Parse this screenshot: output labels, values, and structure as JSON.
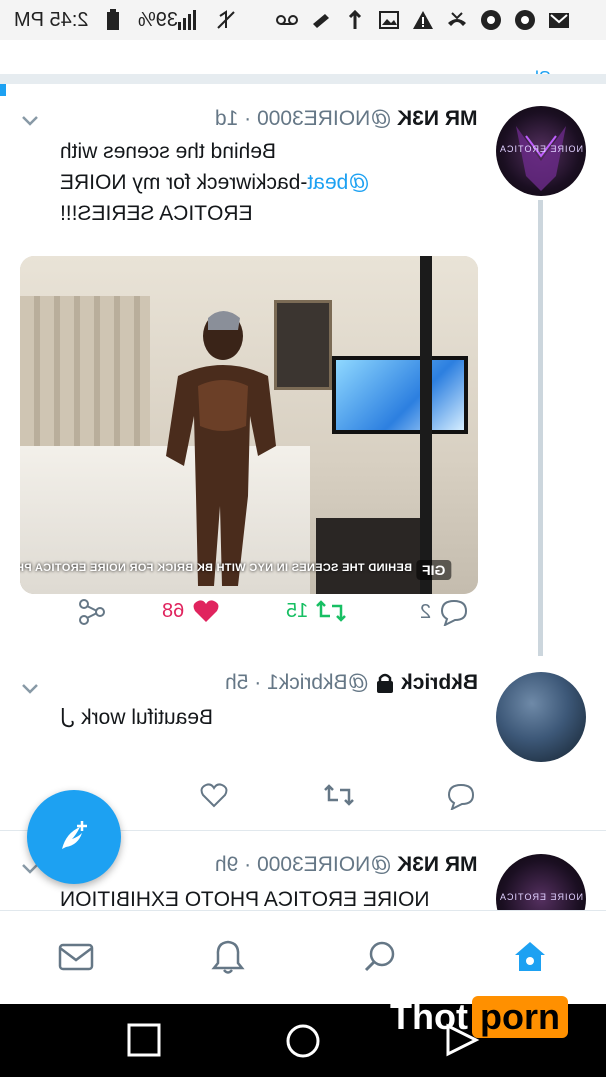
{
  "status_bar": {
    "time": "2:45 PM",
    "battery": "39%",
    "network": "LTE",
    "icons": [
      "signal-icon",
      "mute-icon",
      "voicemail-icon",
      "slash-icon",
      "upload-icon",
      "image-icon",
      "warning-icon",
      "missed-call-icon",
      "chrome-icon",
      "chrome-icon",
      "gmail-icon"
    ]
  },
  "feed": {
    "show_more": "Show more"
  },
  "tweets": [
    {
      "name": "MR N3K",
      "handle": "@NOIRE3000 · 1d",
      "avatar_label": "NOIRE EROTICA",
      "body_lines": [
        "Behind the scenes with",
        "-backiwreck for my NOIRE",
        "EROTICA SERIES!!!"
      ],
      "mention": "@beat",
      "media": {
        "badge": "GIF",
        "caption": "BEHIND THE SCENES IN NYC WITH BK BRICK FOR NOIRE EROTICA PHOTO SERIES"
      },
      "actions": {
        "replies": "2",
        "retweets": "15",
        "likes": "68"
      }
    },
    {
      "name": "Bkbrick",
      "handle": "@Bkbrick1 · 5h",
      "body_lines": [
        "Beautiful work ل"
      ],
      "actions": {
        "replies": "",
        "retweets": "",
        "likes": ""
      }
    },
    {
      "name": "MR N3K",
      "handle": "@NOIRE3000 · 9h",
      "avatar_label": "NOIRE EROTICA",
      "body_lines": [
        "NOIRE EROTICA PHOTO EXHIBITION"
      ]
    }
  ],
  "tabs": [
    "home-tab",
    "search-tab",
    "notifications-tab",
    "messages-tab"
  ],
  "watermark": {
    "part1": "Thot",
    "part2": "porn"
  },
  "colors": {
    "accent": "#1da1f2",
    "like": "#e0245e",
    "retweet": "#17bf63",
    "muted": "#657786"
  }
}
